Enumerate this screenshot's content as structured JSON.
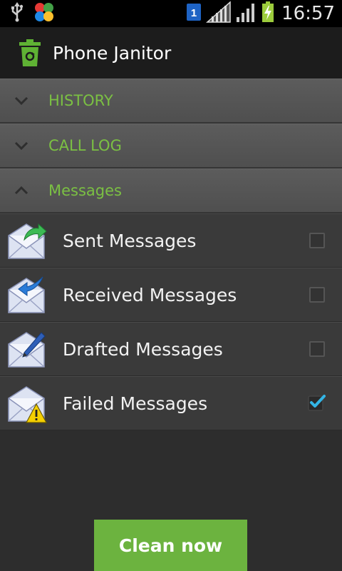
{
  "status_bar": {
    "time": "16:57",
    "sim_label": "1"
  },
  "app": {
    "title": "Phone Janitor"
  },
  "groups": [
    {
      "label": "HISTORY",
      "expanded": false
    },
    {
      "label": "CALL LOG",
      "expanded": false
    },
    {
      "label": "Messages",
      "expanded": true
    }
  ],
  "items": [
    {
      "label": "Sent Messages",
      "checked": false,
      "icon": "envelope-sent-icon"
    },
    {
      "label": "Received Messages",
      "checked": false,
      "icon": "envelope-received-icon"
    },
    {
      "label": "Drafted Messages",
      "checked": false,
      "icon": "envelope-draft-icon"
    },
    {
      "label": "Failed Messages",
      "checked": true,
      "icon": "envelope-failed-icon"
    }
  ],
  "actions": {
    "clean_label": "Clean now"
  },
  "colors": {
    "accent": "#7bc043",
    "button": "#6cb33f",
    "check": "#33b5e5"
  }
}
